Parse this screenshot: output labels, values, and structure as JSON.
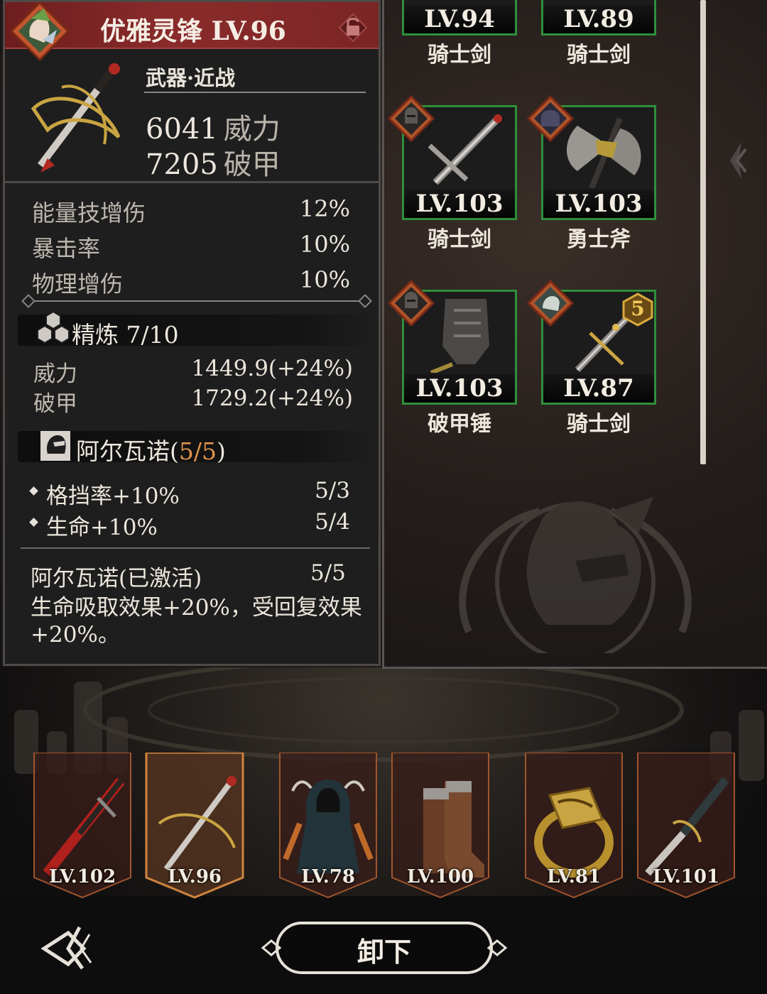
{
  "detail": {
    "title": "优雅灵锋 LV.96",
    "category": "武器·近战",
    "main_stats": {
      "power_value": "6041",
      "power_label": "威力",
      "pierce_value": "7205",
      "pierce_label": "破甲"
    },
    "sub_stats": [
      {
        "label": "能量技增伤",
        "value": "12%"
      },
      {
        "label": "暴击率",
        "value": "10%"
      },
      {
        "label": "物理增伤",
        "value": "10%"
      }
    ],
    "refine": {
      "label": "精炼 7/10",
      "stats": [
        {
          "label": "威力",
          "value": "1449.9(+24%)"
        },
        {
          "label": "破甲",
          "value": "1729.2(+24%)"
        }
      ]
    },
    "set": {
      "name_prefix": "阿尔瓦诺(",
      "count": "5/5",
      "name_suffix": ")",
      "bonuses": [
        {
          "label": "格挡率+10%",
          "value": "5/3"
        },
        {
          "label": "生命+10%",
          "value": "5/4"
        }
      ],
      "active_name": "阿尔瓦诺(已激活)",
      "active_count": "5/5",
      "effect": "生命吸取效果+20%，受回复效果+20%。"
    }
  },
  "inventory": [
    {
      "level": "LV.94",
      "name": "骑士剑",
      "icon": "sword-icon"
    },
    {
      "level": "LV.89",
      "name": "骑士剑",
      "icon": "sword-icon"
    },
    {
      "level": "LV.103",
      "name": "骑士剑",
      "icon": "sword-icon"
    },
    {
      "level": "LV.103",
      "name": "勇士斧",
      "icon": "axe-icon"
    },
    {
      "level": "LV.103",
      "name": "破甲锤",
      "icon": "hammer-icon"
    },
    {
      "level": "LV.87",
      "name": "骑士剑",
      "icon": "sword-icon",
      "star_badge": "5"
    }
  ],
  "equipped": [
    {
      "level": "LV.102",
      "icon": "red-blade-icon"
    },
    {
      "level": "LV.96",
      "icon": "rapier-icon"
    },
    {
      "level": "LV.78",
      "icon": "hooded-cloak-icon"
    },
    {
      "level": "LV.100",
      "icon": "boots-icon"
    },
    {
      "level": "LV.81",
      "icon": "ring-icon"
    },
    {
      "level": "LV.101",
      "icon": "dagger-icon"
    }
  ],
  "footer": {
    "unequip_label": "卸下"
  },
  "colors": {
    "rarity_green": "#2f8f3a",
    "title_red": "#8a2b2b",
    "highlight_orange": "#e0944a"
  }
}
